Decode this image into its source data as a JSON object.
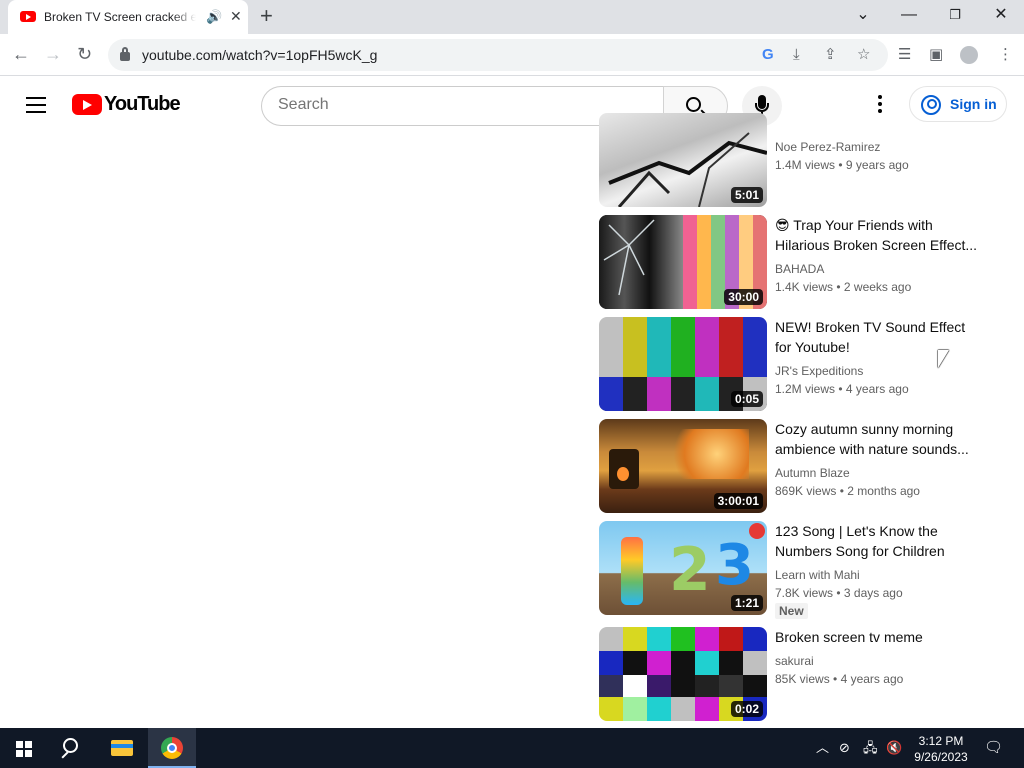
{
  "browser": {
    "tab_title": "Broken TV Screen cracked effect",
    "url": "youtube.com/watch?v=1opFH5wcK_g",
    "new_tab": "+"
  },
  "youtube": {
    "logo_text": "YouTube",
    "search_placeholder": "Search",
    "signin_label": "Sign in"
  },
  "videos": [
    {
      "title": "",
      "channel": "Noe Perez-Ramirez",
      "views": "1.4M views",
      "age": "9 years ago",
      "duration": "5:01"
    },
    {
      "title": "😎 Trap Your Friends with Hilarious Broken Screen Effect...",
      "channel": "BAHADA",
      "views": "1.4K views",
      "age": "2 weeks ago",
      "duration": "30:00"
    },
    {
      "title": "NEW! Broken TV Sound Effect for Youtube!",
      "channel": "JR's Expeditions",
      "views": "1.2M views",
      "age": "4 years ago",
      "duration": "0:05"
    },
    {
      "title": "Cozy autumn sunny morning ambience with nature sounds...",
      "channel": "Autumn Blaze",
      "views": "869K views",
      "age": "2 months ago",
      "duration": "3:00:01"
    },
    {
      "title": "123 Song | Let's Know the Numbers Song for Children",
      "channel": "Learn with Mahi",
      "views": "7.8K views",
      "age": "3 days ago",
      "duration": "1:21",
      "badge": "New"
    },
    {
      "title": "Broken screen tv meme",
      "channel": "sakurai",
      "views": "85K views",
      "age": "4 years ago",
      "duration": "0:02"
    }
  ],
  "taskbar": {
    "time": "3:12 PM",
    "date": "9/26/2023"
  },
  "colors": {
    "youtube_red": "#ff0000",
    "link_blue": "#065fd4",
    "taskbar": "#101826"
  }
}
